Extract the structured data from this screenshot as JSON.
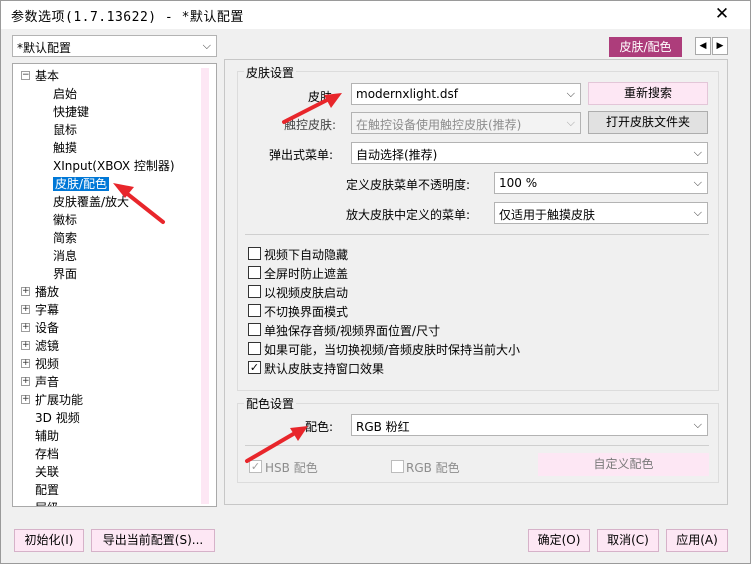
{
  "window": {
    "title": "参数选项(1.7.13622) - *默认配置",
    "close_glyph": "✕"
  },
  "profile_selector": {
    "value": "*默认配置"
  },
  "tab_header": {
    "label": "皮肤/配色"
  },
  "tree": {
    "items": [
      {
        "label": "基本",
        "level": 0,
        "expander": "−"
      },
      {
        "label": "启始",
        "level": 1
      },
      {
        "label": "快捷键",
        "level": 1
      },
      {
        "label": "鼠标",
        "level": 1
      },
      {
        "label": "触摸",
        "level": 1
      },
      {
        "label": "XInput(XBOX 控制器)",
        "level": 1
      },
      {
        "label": "皮肤/配色",
        "level": 1,
        "selected": true
      },
      {
        "label": "皮肤覆盖/放大",
        "level": 1
      },
      {
        "label": "徽标",
        "level": 1
      },
      {
        "label": "简索",
        "level": 1
      },
      {
        "label": "消息",
        "level": 1
      },
      {
        "label": "界面",
        "level": 1
      },
      {
        "label": "播放",
        "level": 0,
        "expander": "+"
      },
      {
        "label": "字幕",
        "level": 0,
        "expander": "+"
      },
      {
        "label": "设备",
        "level": 0,
        "expander": "+"
      },
      {
        "label": "滤镜",
        "level": 0,
        "expander": "+"
      },
      {
        "label": "视频",
        "level": 0,
        "expander": "+"
      },
      {
        "label": "声音",
        "level": 0,
        "expander": "+"
      },
      {
        "label": "扩展功能",
        "level": 0,
        "expander": "+"
      },
      {
        "label": "3D 视频",
        "level": 0
      },
      {
        "label": "辅助",
        "level": 0
      },
      {
        "label": "存档",
        "level": 0
      },
      {
        "label": "关联",
        "level": 0
      },
      {
        "label": "配置",
        "level": 0
      },
      {
        "label": "层级",
        "level": 0
      }
    ]
  },
  "skin_group": {
    "title": "皮肤设置",
    "skin_label": "皮肤:",
    "skin_value": "modernxlight.dsf",
    "rescan_button": "重新搜索",
    "touch_label": "触控皮肤:",
    "touch_value": "在触控设备使用触控皮肤(推荐)",
    "open_folder_button": "打开皮肤文件夹",
    "popup_label": "弹出式菜单:",
    "popup_value": "自动选择(推荐)",
    "opacity_label": "定义皮肤菜单不透明度:",
    "opacity_value": "100 %",
    "zoom_menu_label": "放大皮肤中定义的菜单:",
    "zoom_menu_value": "仅适用于触摸皮肤"
  },
  "checkboxes": [
    {
      "label": "视频下自动隐藏",
      "checked": false
    },
    {
      "label": "全屏时防止遮盖",
      "checked": false
    },
    {
      "label": "以视频皮肤启动",
      "checked": false
    },
    {
      "label": "不切换界面模式",
      "checked": false
    },
    {
      "label": "单独保存音频/视频界面位置/尺寸",
      "checked": false
    },
    {
      "label": "如果可能，当切换视频/音频皮肤时保持当前大小",
      "checked": false
    },
    {
      "label": "默认皮肤支持窗口效果",
      "checked": true
    }
  ],
  "color_group": {
    "title": "配色设置",
    "color_label": "配色:",
    "color_value": "RGB 粉红",
    "hsb_label": "HSB 配色",
    "rgb_label": "RGB 配色",
    "custom_button": "自定义配色"
  },
  "footer": {
    "reset_button": "初始化(I)",
    "export_button": "导出当前配置(S)...",
    "ok_button": "确定(O)",
    "cancel_button": "取消(C)",
    "apply_button": "应用(A)"
  },
  "colors": {
    "accent": "#ad3d7b",
    "pink": "#fde7f4",
    "selection": "#0078d7",
    "annotation_arrow": "#e8262b"
  }
}
